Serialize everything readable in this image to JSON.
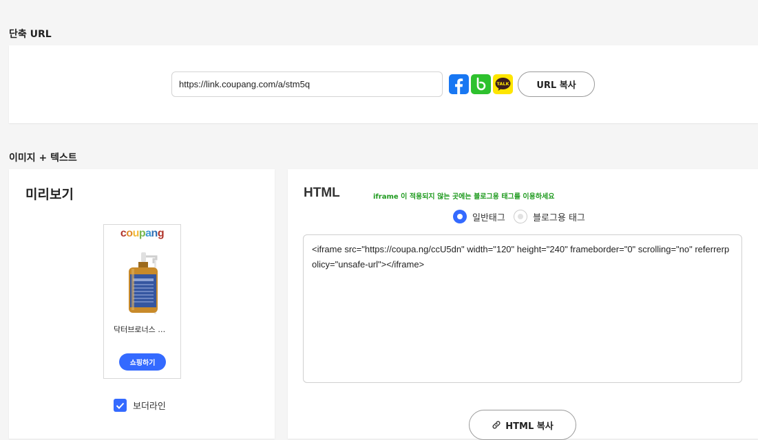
{
  "short_url": {
    "section_title": "단축 URL",
    "url_value": "https://link.coupang.com/a/stm5q",
    "share_icons": [
      "facebook-icon",
      "band-icon",
      "kakaotalk-icon"
    ],
    "kakao_label": "TALK",
    "copy_label": "URL 복사"
  },
  "image_text": {
    "section_title": "이미지 + 텍스트",
    "preview": {
      "title": "미리보기",
      "logo_letters": [
        "c",
        "o",
        "u",
        "p",
        "a",
        "n",
        "g"
      ],
      "logo_colors": [
        "#b1352b",
        "#e18c2c",
        "#f1bb3a",
        "#77b74f",
        "#3e99d4",
        "#2f6fb5",
        "#b1352b"
      ],
      "product_name": "닥터브로너스 …",
      "shop_button": "쇼핑하기",
      "border_line_label": "보더라인",
      "border_line_checked": true
    },
    "html": {
      "title": "HTML",
      "notice": "iframe 이 적용되지 않는 곳에는 블로그용 태그를 이용하세요",
      "tag_options": [
        {
          "label": "일반태그",
          "selected": true
        },
        {
          "label": "블로그용 태그",
          "selected": false
        }
      ],
      "code": "<iframe src=\"https://coupa.ng/ccU5dn\" width=\"120\" height=\"240\" frameborder=\"0\" scrolling=\"no\" referrerpolicy=\"unsafe-url\"></iframe>",
      "copy_label": "HTML 복사"
    }
  },
  "colors": {
    "accent": "#346aff",
    "notice": "#1e9a1e",
    "facebook": "#1877f2",
    "band": "#2ec12e",
    "kakao": "#fee500"
  }
}
